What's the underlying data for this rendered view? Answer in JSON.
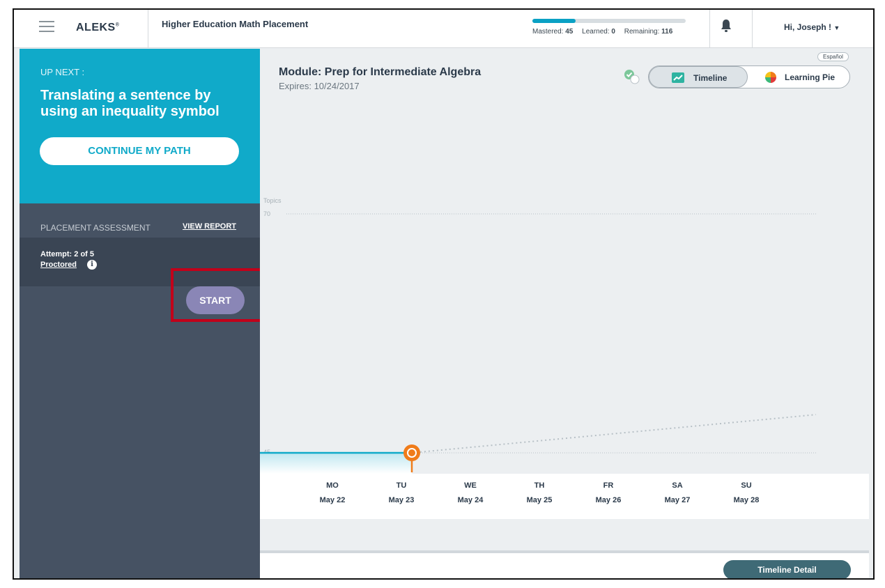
{
  "header": {
    "logo": "ALEKS",
    "logo_mark": "®",
    "course": "Higher Education Math Placement",
    "progress_fraction": 0.28,
    "mastered_label": "Mastered:",
    "mastered_value": "45",
    "learned_label": "Learned:",
    "learned_value": "0",
    "remaining_label": "Remaining:",
    "remaining_value": "116",
    "greeting": "Hi, Joseph !"
  },
  "sidebar": {
    "up_next": "UP NEXT :",
    "topic": "Translating a sentence by using an inequality symbol",
    "continue_label": "CONTINUE MY PATH",
    "placement_label": "PLACEMENT ASSESSMENT",
    "view_report": "VIEW REPORT",
    "attempt": "Attempt: 2 of 5",
    "proctored": "Proctored",
    "start": "START"
  },
  "main": {
    "espanol": "Español",
    "module_title": "Module: Prep for Intermediate Algebra",
    "expires": "Expires: 10/24/2017",
    "toggle_timeline": "Timeline",
    "toggle_pie": "Learning Pie",
    "timeline_detail": "Timeline Detail"
  },
  "chart_data": {
    "type": "line",
    "ylabel": "Topics",
    "y_ticks": [
      "70",
      "45"
    ],
    "ylim": [
      45,
      70
    ],
    "x": [
      "MO",
      "TU",
      "WE",
      "TH",
      "FR",
      "SA",
      "SU"
    ],
    "dates": [
      "May 22",
      "May 23",
      "May 24",
      "May 25",
      "May 26",
      "May 27",
      "May 28"
    ],
    "current_day": "TU",
    "series": [
      {
        "values": [
          45,
          45
        ]
      }
    ],
    "projection": {
      "from": 45,
      "to": 49
    }
  },
  "colors": {
    "teal": "#10aac9",
    "dark_sidebar": "#465263",
    "start_button": "#8a86b6",
    "highlight": "#c2001a",
    "marker": "#f07c1a"
  }
}
